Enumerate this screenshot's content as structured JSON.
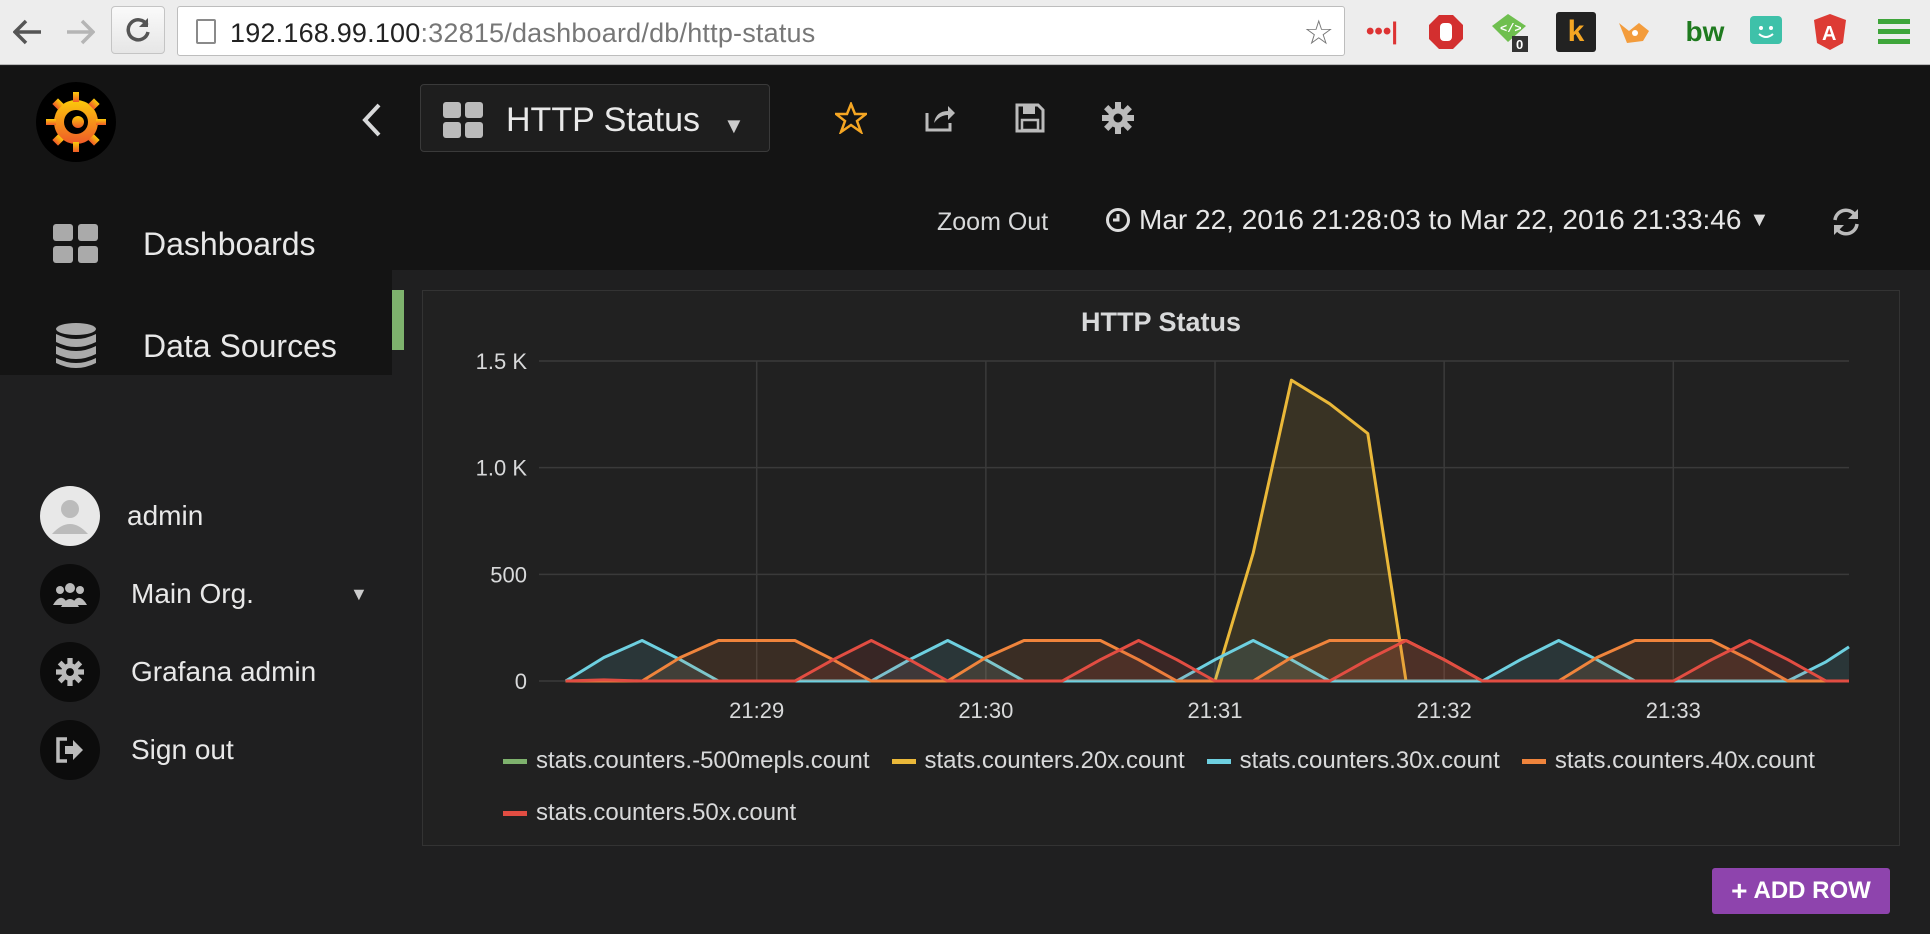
{
  "browser": {
    "url_host": "192.168.99.100",
    "url_rest": ":32815/dashboard/db/http-status"
  },
  "dashboard": {
    "title": "HTTP Status"
  },
  "sidebar": {
    "items": [
      {
        "label": "Dashboards",
        "icon": "dashboards-icon"
      },
      {
        "label": "Data Sources",
        "icon": "database-icon"
      }
    ],
    "user": {
      "name": "admin"
    },
    "org": {
      "name": "Main Org."
    },
    "admin": {
      "label": "Grafana admin"
    },
    "signout": {
      "label": "Sign out"
    }
  },
  "subbar": {
    "zoom_out": "Zoom Out",
    "time_range": "Mar 22, 2016 21:28:03 to Mar 22, 2016 21:33:46"
  },
  "panel": {
    "title": "HTTP Status"
  },
  "add_row": "ADD ROW",
  "colors": {
    "green": "#7eb26d",
    "yellow": "#eab839",
    "cyan": "#6ed0e0",
    "orange": "#ef843c",
    "red": "#e24d42",
    "accent_purple": "#8e44ad"
  },
  "chart_data": {
    "type": "area",
    "title": "HTTP Status",
    "x_tick_labels": [
      "21:29",
      "21:30",
      "21:31",
      "21:32",
      "21:33"
    ],
    "y_tick_labels": [
      "0",
      "500",
      "1.0 K",
      "1.5 K"
    ],
    "y_ticks": [
      0,
      500,
      1000,
      1500
    ],
    "ylim": [
      0,
      1500
    ],
    "x": [
      "21:28:10",
      "21:28:20",
      "21:28:30",
      "21:28:40",
      "21:28:50",
      "21:29:00",
      "21:29:10",
      "21:29:20",
      "21:29:30",
      "21:29:40",
      "21:29:50",
      "21:30:00",
      "21:30:10",
      "21:30:20",
      "21:30:30",
      "21:30:40",
      "21:30:50",
      "21:31:00",
      "21:31:10",
      "21:31:20",
      "21:31:30",
      "21:31:40",
      "21:31:50",
      "21:32:00",
      "21:32:10",
      "21:32:20",
      "21:32:30",
      "21:32:40",
      "21:32:50",
      "21:33:00",
      "21:33:10",
      "21:33:20",
      "21:33:30",
      "21:33:40",
      "21:33:46"
    ],
    "series": [
      {
        "name": "stats.counters.-500mepls.count",
        "color": "#7eb26d",
        "values": [
          0,
          0,
          0,
          0,
          0,
          0,
          0,
          0,
          0,
          0,
          0,
          0,
          0,
          0,
          0,
          0,
          0,
          0,
          0,
          0,
          0,
          0,
          0,
          0,
          0,
          0,
          0,
          0,
          0,
          0,
          0,
          0,
          0,
          0,
          0
        ]
      },
      {
        "name": "stats.counters.20x.count",
        "color": "#eab839",
        "values": [
          0,
          0,
          0,
          0,
          0,
          0,
          0,
          0,
          0,
          0,
          0,
          0,
          0,
          0,
          0,
          0,
          0,
          0,
          600,
          1410,
          1300,
          1160,
          0,
          0,
          0,
          0,
          0,
          0,
          0,
          0,
          0,
          0,
          0,
          0,
          0
        ]
      },
      {
        "name": "stats.counters.30x.count",
        "color": "#6ed0e0",
        "values": [
          0,
          110,
          190,
          100,
          0,
          0,
          0,
          0,
          0,
          100,
          190,
          100,
          0,
          0,
          0,
          0,
          0,
          100,
          190,
          100,
          0,
          0,
          0,
          0,
          0,
          100,
          190,
          100,
          0,
          0,
          0,
          0,
          0,
          90,
          160
        ]
      },
      {
        "name": "stats.counters.40x.count",
        "color": "#ef843c",
        "values": [
          0,
          0,
          0,
          110,
          190,
          190,
          190,
          100,
          0,
          0,
          0,
          110,
          190,
          190,
          190,
          100,
          0,
          0,
          0,
          110,
          190,
          190,
          190,
          100,
          0,
          0,
          0,
          110,
          190,
          190,
          190,
          100,
          0,
          0,
          0
        ]
      },
      {
        "name": "stats.counters.50x.count",
        "color": "#e24d42",
        "values": [
          0,
          5,
          0,
          0,
          0,
          0,
          0,
          100,
          190,
          100,
          0,
          0,
          0,
          0,
          100,
          190,
          100,
          0,
          0,
          0,
          0,
          100,
          190,
          100,
          0,
          0,
          0,
          0,
          0,
          0,
          100,
          190,
          100,
          0,
          0
        ]
      }
    ]
  }
}
